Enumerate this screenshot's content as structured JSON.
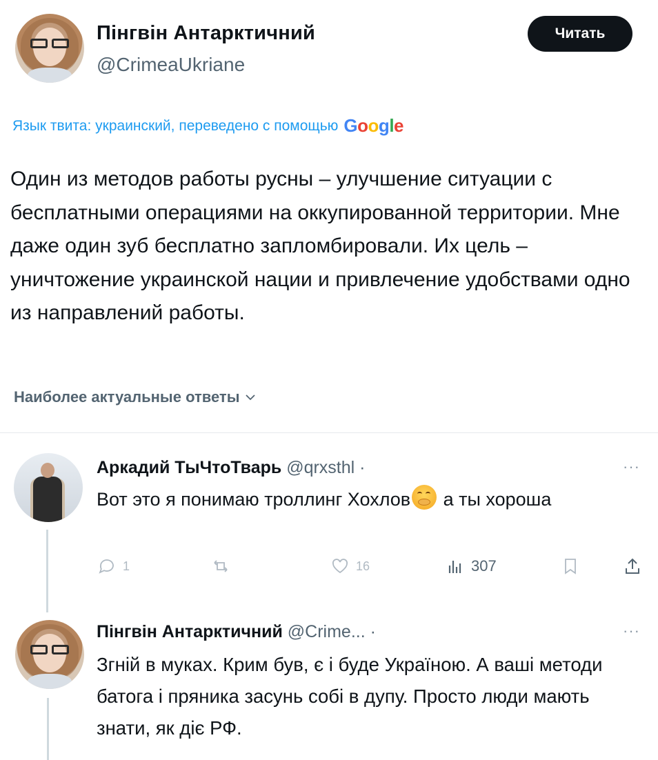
{
  "tweet": {
    "author_name": "Пінгвін Антарктичний",
    "author_handle": "@CrimeaUkriane",
    "follow_label": "Читать",
    "translation_note": "Язык твита: украинский, переведено с помощью",
    "translation_provider": "Google",
    "text": "Один из методов работы русны – улучшение ситуации с бесплатными операциями на оккупированной территории. Мне даже один зуб бесплатно запломбировали. Их цель – уничтожение украинской нации и привлечение удобствами одно из направлений работы."
  },
  "replies_sort_label": "Наиболее актуальные ответы",
  "replies": [
    {
      "author_name": "Аркадий ТыЧтоТварь",
      "author_handle": "@qrxsthl ·",
      "more_label": "···",
      "text_before_emoji": "Вот это я понимаю троллинг Хохлов",
      "emoji": "face-with-hand-over-mouth-emoji",
      "text_after_emoji": " а ты хороша",
      "stats": {
        "replies": "1",
        "retweets": "",
        "likes": "16",
        "views": "307"
      }
    },
    {
      "author_name": "Пінгвін Антарктичний",
      "author_handle": "@Crime... ·",
      "more_label": "···",
      "text": "Згній в муках. Крим був, є і буде Україною. А ваші методи батога і пряника засунь собі в дупу. Просто люди мають знати, як діє РФ."
    }
  ],
  "colors": {
    "link_blue": "#1d9bf0",
    "secondary_text": "#536471",
    "button_bg": "#0f1419"
  }
}
